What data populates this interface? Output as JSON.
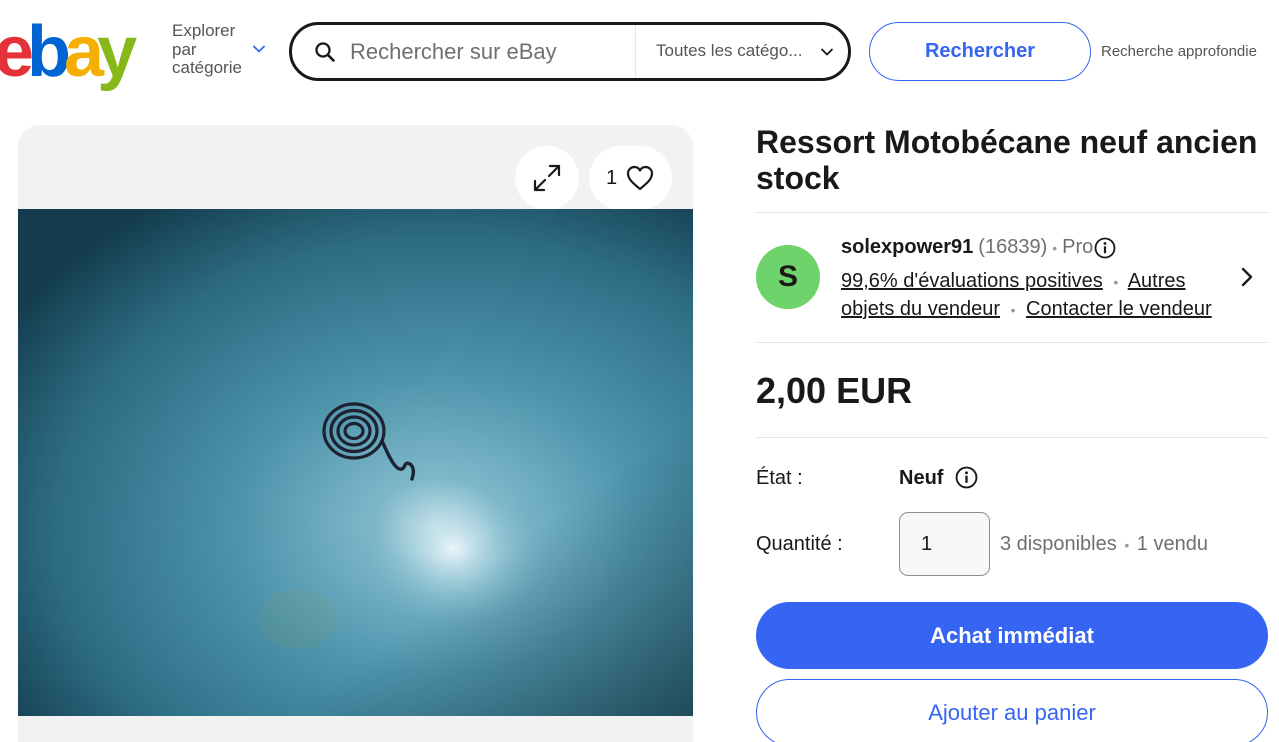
{
  "header": {
    "logo_letters": [
      "e",
      "b",
      "a",
      "y"
    ],
    "logo_colors": [
      "#e53238",
      "#0064d2",
      "#f5af02",
      "#86b817"
    ],
    "explore_label_lines": [
      "Explorer",
      "par",
      "catégorie"
    ],
    "search_placeholder": "Rechercher sur eBay",
    "category_selected": "Toutes les catégo...",
    "search_button": "Rechercher",
    "advanced_search": "Recherche approfondie"
  },
  "gallery": {
    "watch_count": "1",
    "icons": [
      "expand-icon",
      "heart-icon"
    ]
  },
  "listing": {
    "title": "Ressort Motobécane neuf ancien stock",
    "seller": {
      "avatar_letter": "S",
      "avatar_color": "#6ed36a",
      "name": "solexpower91",
      "score": "(16839)",
      "badge": "Pro",
      "feedback": "99,6% d'évaluations positives",
      "other_items": "Autres objets du vendeur",
      "contact": "Contacter le vendeur"
    },
    "price": "2,00 EUR",
    "condition_label": "État :",
    "condition_value": "Neuf",
    "quantity_label": "Quantité :",
    "quantity_value": "1",
    "available": "3 disponibles",
    "sold": "1 vendu",
    "buy_now": "Achat immédiat",
    "add_to_cart": "Ajouter au panier"
  },
  "colors": {
    "accent": "#3665f3",
    "text": "#191919",
    "muted": "#707070"
  }
}
